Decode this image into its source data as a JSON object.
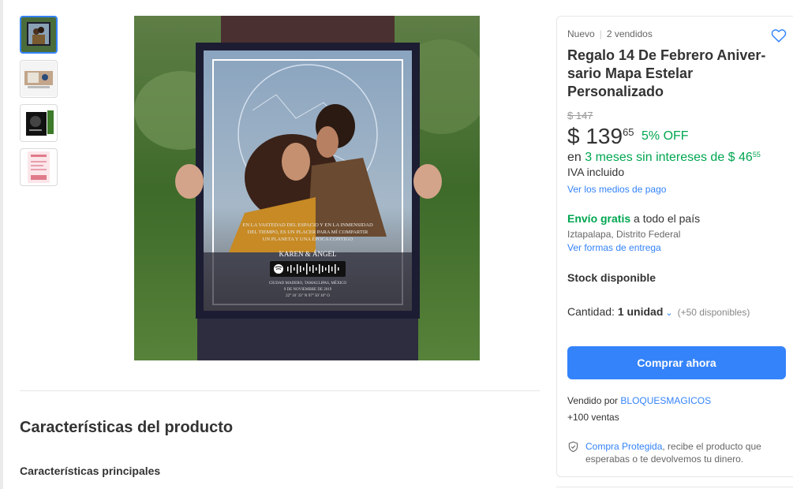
{
  "gallery": {
    "thumbnails": [
      "photo-couple",
      "product-spotify-plaque",
      "product-black-frame",
      "product-pink-card"
    ],
    "selected_index": 0
  },
  "photo_frame": {
    "poem": "EN LA VASTEDAD DEL ESPACIO Y EN LA INMENSIDAD DEL TIEMPO, ES UN PLACER PARA MÍ COMPARTIR UN PLANETA Y UNA ÉPOCA CONTIGO",
    "names": "KAREN & ÁNGEL",
    "place_line1": "CIUDAD MADERO, TAMAULIPAS, MÉXICO",
    "place_line2": "9 DE NOVIEMBRE DE 2019",
    "coords": "22° 16' 33\" N 97° 50' 10\" O"
  },
  "characteristics": {
    "title": "Características del producto",
    "subtitle": "Características principales"
  },
  "panel": {
    "condition": "Nuevo",
    "sold": "2 vendidos",
    "title": "Regalo 14 De Febrero Aniver-sario Mapa Estelar Personalizado",
    "original_price": "$ 147",
    "price_currency": "$",
    "price_int": "139",
    "price_cents": "65",
    "discount": "5% OFF",
    "installments_prefix": "en ",
    "installments_green": "3 meses sin intereses de $ 46",
    "installments_cents": "55",
    "iva": "IVA incluido",
    "payment_link": "Ver los medios de pago",
    "shipping_bold": "Envío gratis",
    "shipping_rest": " a todo el país",
    "shipping_location": "Iztapalapa, Distrito Federal",
    "shipping_link": "Ver formas de entrega",
    "stock": "Stock disponible",
    "quantity_label": "Cantidad: ",
    "quantity_value": "1 unidad",
    "quantity_available": "(+50 disponibles)",
    "buy_button": "Comprar ahora",
    "seller_prefix": "Vendido por ",
    "seller_name": "BLOQUESMAGICOS",
    "seller_sales": "+100 ventas",
    "protect_link": "Compra Protegida",
    "protect_text": ", recibe el producto que esperabas o te devolvemos tu dinero."
  },
  "colors": {
    "accent_blue": "#3483fa",
    "green": "#00a650"
  },
  "icons": [
    "heart-icon",
    "chevron-down-icon",
    "shield-icon",
    "spotify-icon"
  ]
}
